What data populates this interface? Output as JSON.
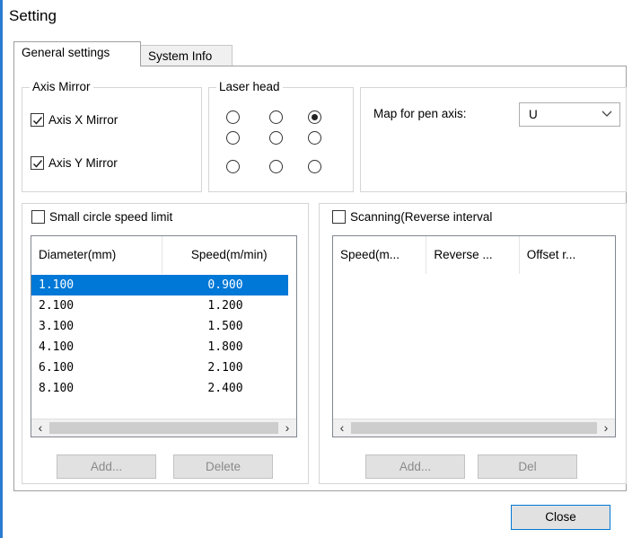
{
  "window": {
    "title": "Setting"
  },
  "tabs": [
    {
      "label": "General settings",
      "active": true
    },
    {
      "label": "System Info",
      "active": false
    }
  ],
  "axis_mirror": {
    "title": "Axis Mirror",
    "x_label": "Axis X Mirror",
    "x_checked": true,
    "y_label": "Axis Y Mirror",
    "y_checked": true
  },
  "laser_head": {
    "title": "Laser head",
    "selected_index": 2
  },
  "pen_axis": {
    "label": "Map for pen axis:",
    "value": "U"
  },
  "small_circle": {
    "checkbox_label": "Small circle speed limit",
    "checked": false,
    "columns": [
      "Diameter(mm)",
      "Speed(m/min)"
    ],
    "rows": [
      [
        "1.100",
        "0.900"
      ],
      [
        "2.100",
        "1.200"
      ],
      [
        "3.100",
        "1.500"
      ],
      [
        "4.100",
        "1.800"
      ],
      [
        "6.100",
        "2.100"
      ],
      [
        "8.100",
        "2.400"
      ]
    ],
    "add_label": "Add...",
    "delete_label": "Delete"
  },
  "scanning": {
    "checkbox_label": "Scanning(Reverse interval",
    "checked": false,
    "columns": [
      "Speed(m...",
      "Reverse ...",
      "Offset r..."
    ],
    "add_label": "Add...",
    "del_label": "Del"
  },
  "footer": {
    "close_label": "Close"
  },
  "colors": {
    "selection": "#0078d7",
    "accent": "#2b7bd1"
  }
}
